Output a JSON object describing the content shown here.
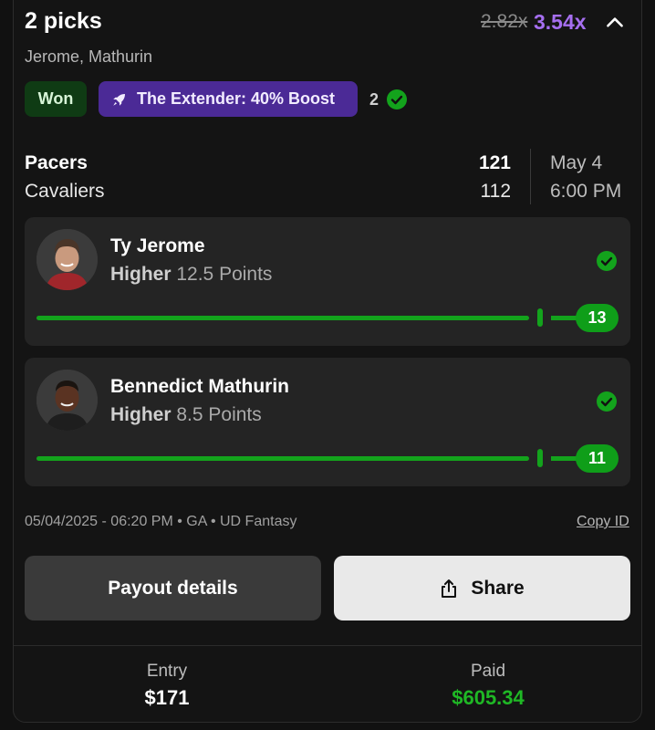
{
  "header": {
    "title": "2 picks",
    "old_multiplier": "2.82x",
    "new_multiplier": "3.54x",
    "players": "Jerome, Mathurin"
  },
  "badges": {
    "status": "Won",
    "boost": "The Extender: 40% Boost",
    "wins_count": "2"
  },
  "game": {
    "team1": "Pacers",
    "team1_score": "121",
    "team2": "Cavaliers",
    "team2_score": "112",
    "date": "May 4",
    "time": "6:00 PM"
  },
  "picks": [
    {
      "player": "Ty Jerome",
      "direction": "Higher",
      "line": "12.5 Points",
      "result": "13",
      "result_progress": 1.04
    },
    {
      "player": "Bennedict Mathurin",
      "direction": "Higher",
      "line": "8.5 Points",
      "result": "11",
      "result_progress": 1.29
    }
  ],
  "meta": {
    "info": "05/04/2025 - 06:20 PM • GA • UD Fantasy",
    "copy_id": "Copy ID"
  },
  "actions": {
    "payout": "Payout details",
    "share": "Share"
  },
  "footer": {
    "entry_label": "Entry",
    "entry_value": "$171",
    "paid_label": "Paid",
    "paid_value": "$605.34"
  },
  "colors": {
    "accent_purple": "#a66ff0",
    "win_green": "#13a31c",
    "paid_green": "#1fb825"
  }
}
